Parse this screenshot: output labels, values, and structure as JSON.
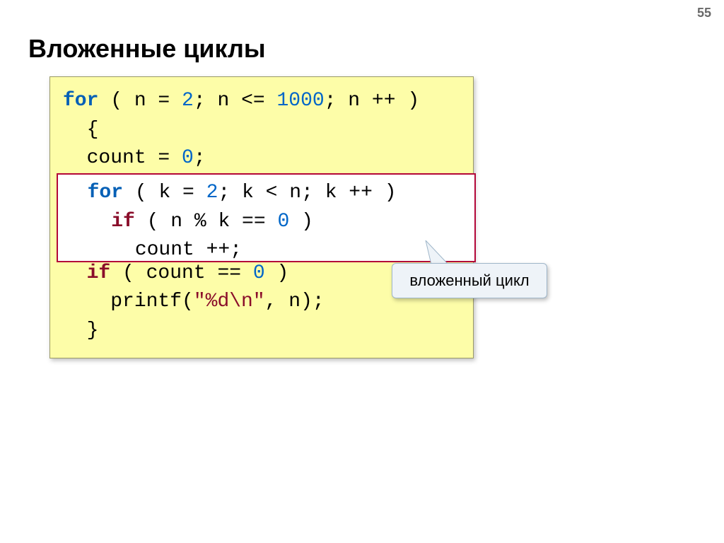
{
  "page_number": "55",
  "title": "Вложенные циклы",
  "callout_label": "вложенный цикл",
  "code": {
    "line1": {
      "for": "for",
      "open": " ( n = ",
      "n1": "2",
      "mid1": "; n <= ",
      "n2": "1000",
      "mid2": "; n ++ )"
    },
    "line2": "  {",
    "line3": {
      "pre": "  count = ",
      "n": "0",
      "post": ";"
    },
    "inner": {
      "l1": {
        "for": "for",
        "open": " ( k = ",
        "n1": "2",
        "mid": "; k < n; k ++ )"
      },
      "l2": {
        "pre": "    ",
        "if": "if",
        "body": " ( n % k == ",
        "n": "0",
        "post": " )"
      },
      "l3": "      count ++;"
    },
    "line7": {
      "pre": "  ",
      "if": "if",
      "body": " ( count == ",
      "n": "0",
      "post": " )"
    },
    "line8": {
      "pre": "    printf(",
      "str": "\"%d\\n\"",
      "post": ", n);"
    },
    "line9": "  }"
  }
}
